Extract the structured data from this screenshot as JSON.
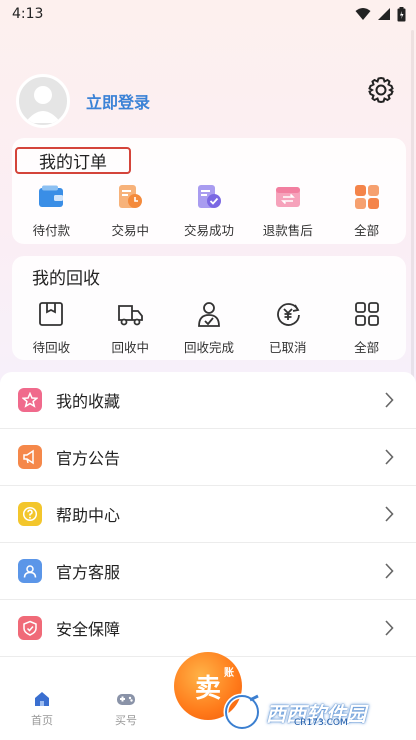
{
  "status_bar": {
    "time": "4:13"
  },
  "profile": {
    "login_label": "立即登录"
  },
  "orders": {
    "title": "我的订单",
    "items": [
      {
        "label": "待付款",
        "icon": "wallet-icon",
        "color": "#3a8ee6"
      },
      {
        "label": "交易中",
        "icon": "trade-clock-icon",
        "color": "#f4a462"
      },
      {
        "label": "交易成功",
        "icon": "trade-success-icon",
        "color": "#8b7be8"
      },
      {
        "label": "退款售后",
        "icon": "refund-icon",
        "color": "#f27fa0"
      },
      {
        "label": "全部",
        "icon": "grid-all-icon",
        "color": "#f4844a"
      }
    ]
  },
  "recycle": {
    "title": "我的回收",
    "items": [
      {
        "label": "待回收",
        "icon": "box-icon"
      },
      {
        "label": "回收中",
        "icon": "truck-icon"
      },
      {
        "label": "回收完成",
        "icon": "person-check-icon"
      },
      {
        "label": "已取消",
        "icon": "yuan-cancel-icon"
      },
      {
        "label": "全部",
        "icon": "grid-outline-icon"
      }
    ]
  },
  "menu": [
    {
      "label": "我的收藏",
      "icon": "star-icon",
      "color": "#f06a8c"
    },
    {
      "label": "官方公告",
      "icon": "megaphone-icon",
      "color": "#f5884a"
    },
    {
      "label": "帮助中心",
      "icon": "help-icon",
      "color": "#f3c62c"
    },
    {
      "label": "官方客服",
      "icon": "service-icon",
      "color": "#5b96e8"
    },
    {
      "label": "安全保障",
      "icon": "shield-icon",
      "color": "#f06a78"
    }
  ],
  "tabbar": {
    "home_label": "首页",
    "buy_label": "买号",
    "sell_label": "卖",
    "sell_small": "账"
  },
  "watermark": {
    "text": "西西软件园",
    "sub": "CR173.COM"
  }
}
